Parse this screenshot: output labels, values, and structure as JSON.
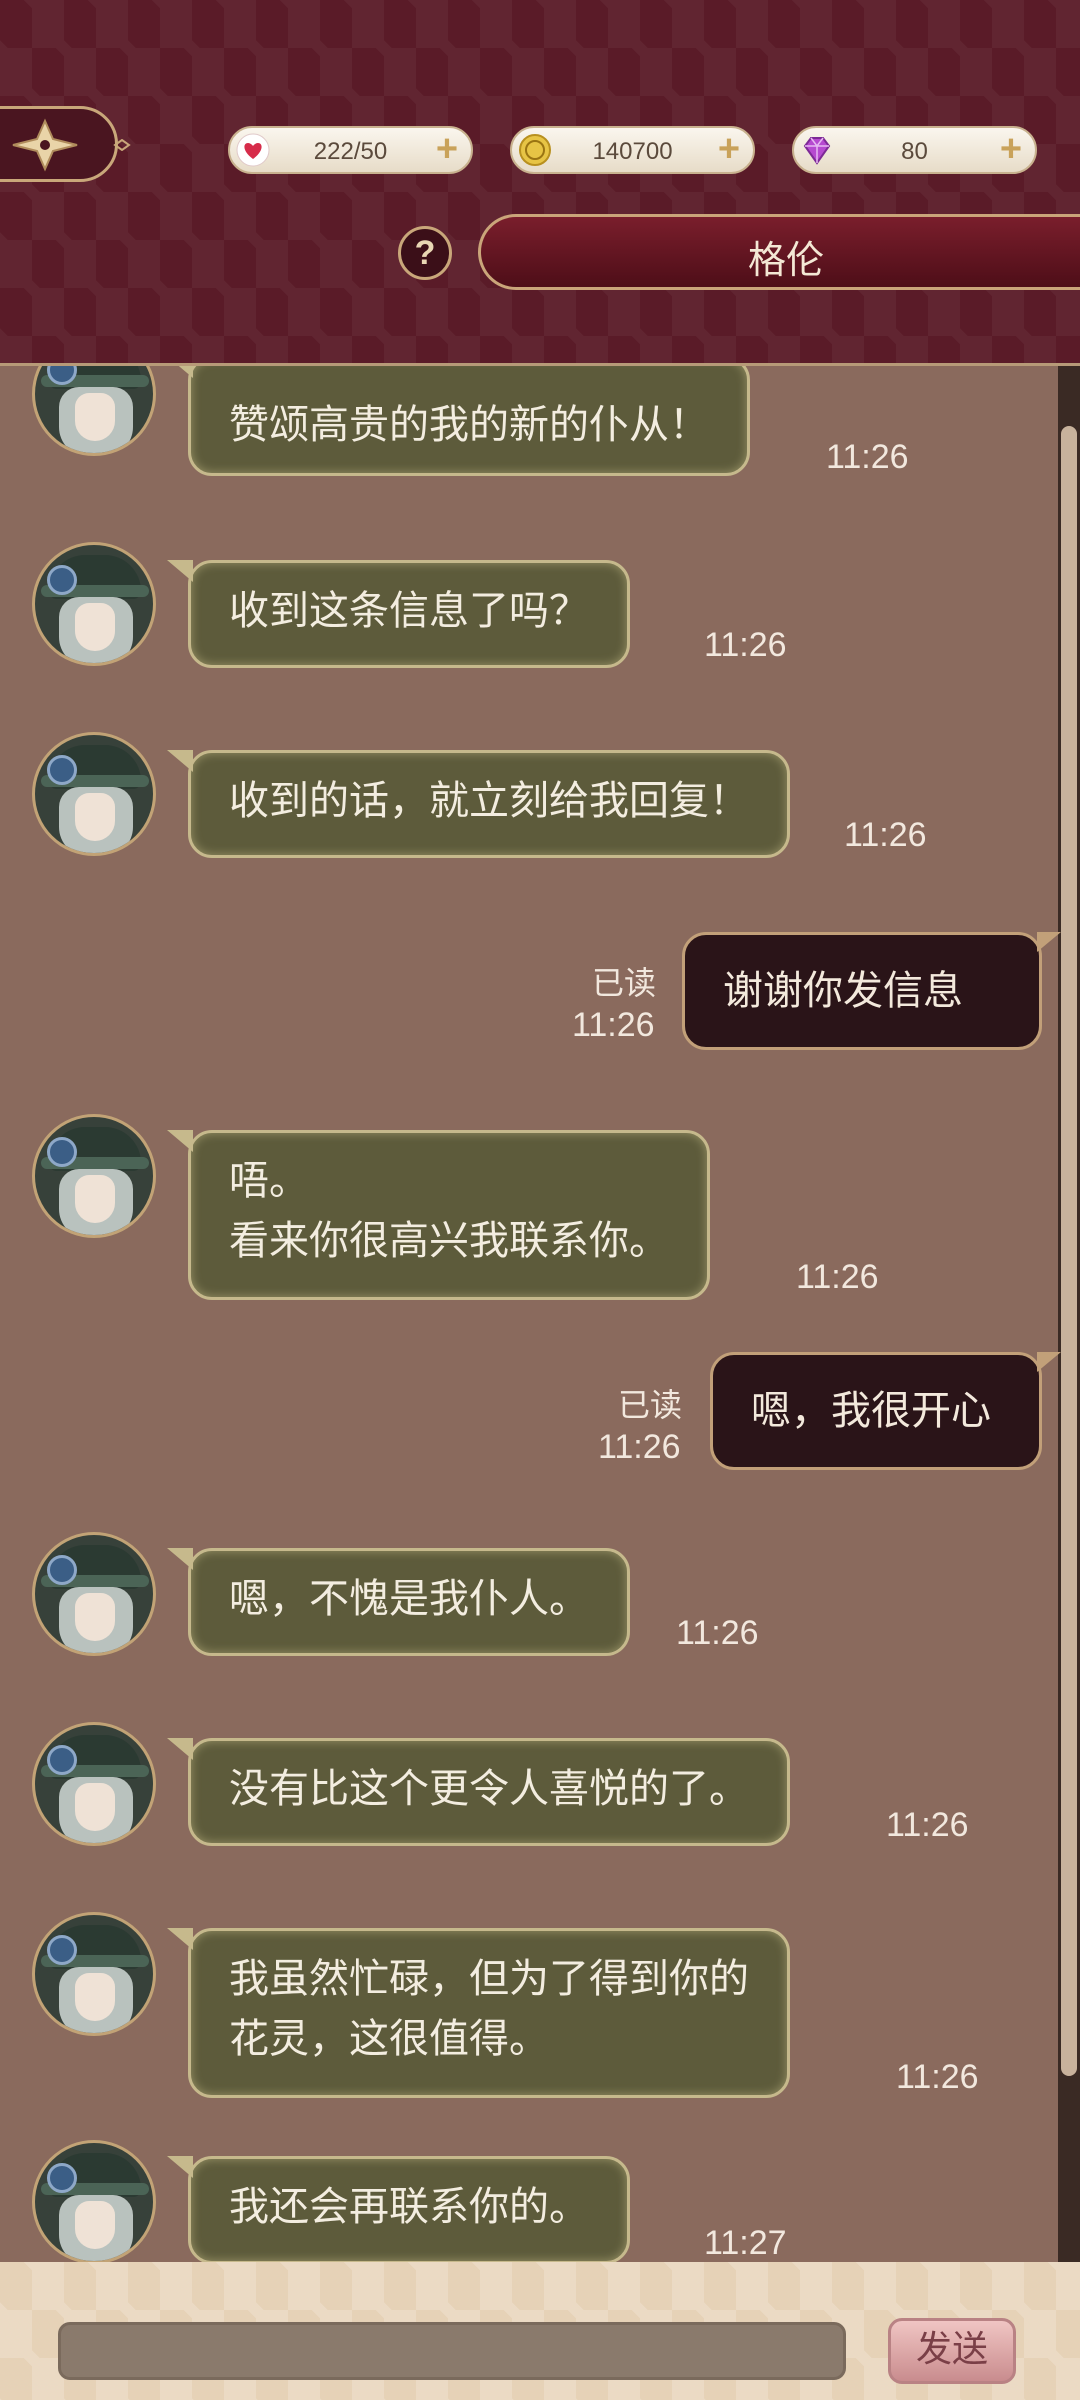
{
  "header": {
    "resources": [
      {
        "icon": "heart-icon",
        "value": "222/50"
      },
      {
        "icon": "coin-icon",
        "value": "140700"
      },
      {
        "icon": "gem-icon",
        "value": "80"
      }
    ],
    "help_label": "?",
    "contact_name": "格伦"
  },
  "messages": [
    {
      "from": "contact",
      "text": "赞颂高贵的我的新的仆从！",
      "time": "11:26"
    },
    {
      "from": "contact",
      "text": "收到这条信息了吗？",
      "time": "11:26"
    },
    {
      "from": "contact",
      "text": "收到的话，就立刻给我回复！",
      "time": "11:26"
    },
    {
      "from": "me",
      "text": "谢谢你发信息",
      "read": "已读",
      "time": "11:26"
    },
    {
      "from": "contact",
      "lines": [
        "唔。",
        "看来你很高兴我联系你。"
      ],
      "time": "11:26"
    },
    {
      "from": "me",
      "text": "嗯，我很开心",
      "read": "已读",
      "time": "11:26"
    },
    {
      "from": "contact",
      "text": "嗯，不愧是我仆人。",
      "time": "11:26"
    },
    {
      "from": "contact",
      "text": "没有比这个更令人喜悦的了。",
      "time": "11:26"
    },
    {
      "from": "contact",
      "lines": [
        "我虽然忙碌，但为了得到你的",
        "花灵，这很值得。"
      ],
      "time": "11:26"
    },
    {
      "from": "contact",
      "text": "我还会再联系你的。",
      "time": "11:27"
    }
  ],
  "input": {
    "placeholder": "",
    "value": ""
  },
  "send_label": "发送",
  "colors": {
    "header_bg": "#5a1b28",
    "chat_bg": "#8a6a5d",
    "bubble_in": "#5d5b3b",
    "bubble_out": "#2a1418"
  }
}
